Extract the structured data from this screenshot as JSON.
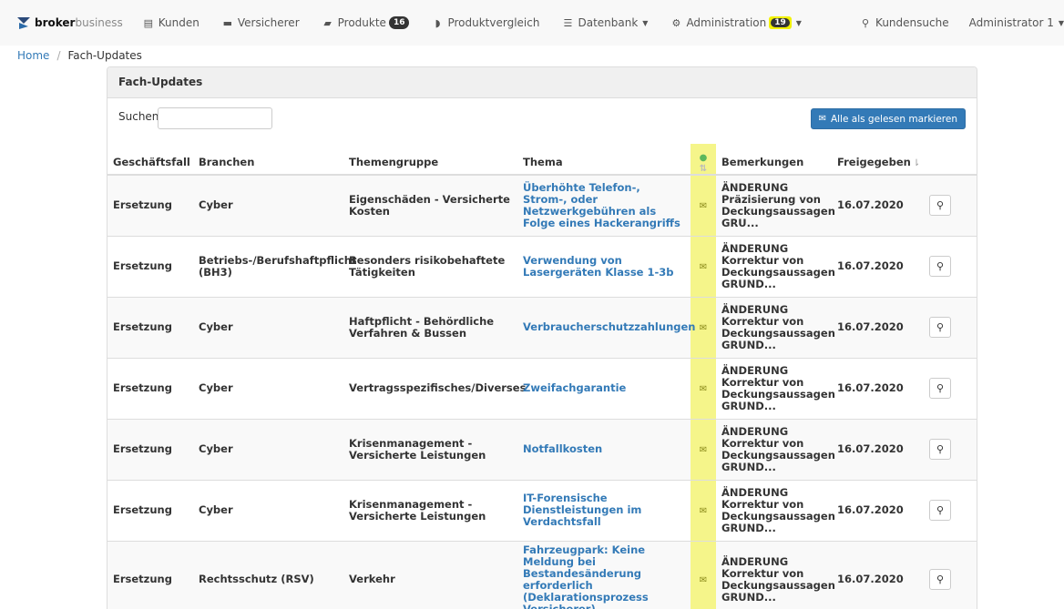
{
  "brand": {
    "bold": "broker",
    "light": "business"
  },
  "nav": {
    "kunden": "Kunden",
    "versicherer": "Versicherer",
    "produkte": "Produkte",
    "produkte_badge": "16",
    "produktvergleich": "Produktvergleich",
    "datenbank": "Datenbank",
    "administration": "Administration",
    "administration_badge": "19",
    "kundensuche": "Kundensuche",
    "user": "Administrator 1"
  },
  "breadcrumb": {
    "home": "Home",
    "current": "Fach-Updates"
  },
  "panel": {
    "title": "Fach-Updates",
    "search_label": "Suchen",
    "search_value": "",
    "mark_all_label": "Alle als gelesen markieren"
  },
  "table": {
    "headers": {
      "geschaeftsfall": "Geschäftsfall",
      "branchen": "Branchen",
      "themengruppe": "Themengruppe",
      "thema": "Thema",
      "bemerkungen": "Bemerkungen",
      "freigegeben": "Freigegeben"
    },
    "rows": [
      {
        "geschaeftsfall": "Ersetzung",
        "branchen": "Cyber",
        "themengruppe": "Eigenschäden - Versicherte Kosten",
        "thema": "Überhöhte Telefon-, Strom-, oder Netzwerkgebühren als Folge eines Hackerangriffs",
        "bemerkungen": "ÄNDERUNG Präzisierung von Deckungsaussagen GRU...",
        "freigegeben": "16.07.2020"
      },
      {
        "geschaeftsfall": "Ersetzung",
        "branchen": "Betriebs-/Berufshaftpflicht (BH3)",
        "themengruppe": "Besonders risikobehaftete Tätigkeiten",
        "thema": "Verwendung von Lasergeräten Klasse 1-3b",
        "bemerkungen": "ÄNDERUNG Korrektur von Deckungsaussagen GRUND...",
        "freigegeben": "16.07.2020"
      },
      {
        "geschaeftsfall": "Ersetzung",
        "branchen": "Cyber",
        "themengruppe": "Haftpflicht - Behördliche Verfahren & Bussen",
        "thema": "Verbraucherschutzzahlungen",
        "bemerkungen": "ÄNDERUNG Korrektur von Deckungsaussagen GRUND...",
        "freigegeben": "16.07.2020"
      },
      {
        "geschaeftsfall": "Ersetzung",
        "branchen": "Cyber",
        "themengruppe": "Vertragsspezifisches/Diverses",
        "thema": "Zweifachgarantie",
        "bemerkungen": "ÄNDERUNG Korrektur von Deckungsaussagen GRUND...",
        "freigegeben": "16.07.2020"
      },
      {
        "geschaeftsfall": "Ersetzung",
        "branchen": "Cyber",
        "themengruppe": "Krisenmanagement - Versicherte Leistungen",
        "thema": "Notfallkosten",
        "bemerkungen": "ÄNDERUNG Korrektur von Deckungsaussagen GRUND...",
        "freigegeben": "16.07.2020"
      },
      {
        "geschaeftsfall": "Ersetzung",
        "branchen": "Cyber",
        "themengruppe": "Krisenmanagement - Versicherte Leistungen",
        "thema": "IT-Forensische Dienstleistungen im Verdachtsfall",
        "bemerkungen": "ÄNDERUNG Korrektur von Deckungsaussagen GRUND...",
        "freigegeben": "16.07.2020"
      },
      {
        "geschaeftsfall": "Ersetzung",
        "branchen": "Rechtsschutz (RSV)",
        "themengruppe": "Verkehr",
        "thema": "Fahrzeugpark: Keine Meldung bei Bestandesänderung erforderlich (Deklarationsprozess Versicherer)",
        "bemerkungen": "ÄNDERUNG Korrektur von Deckungsaussagen GRUND...",
        "freigegeben": "16.07.2020"
      }
    ]
  },
  "icons": {
    "brand": "broker-logo-icon",
    "kunden": "id-card-icon",
    "versicherer": "briefcase-icon",
    "produkte": "book-icon",
    "produktvergleich": "shield-icon",
    "datenbank": "database-icon",
    "administration": "gears-icon",
    "kundensuche": "search-icon",
    "flag": "envelope-icon",
    "view": "search-icon"
  },
  "colors": {
    "accent": "#337ab7",
    "highlight": "#f5f58a"
  }
}
